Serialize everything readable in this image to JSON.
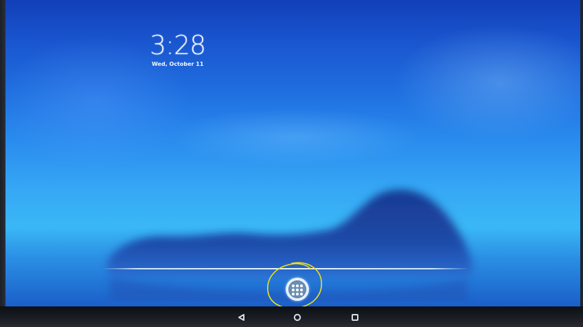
{
  "lockscreen": {
    "time": "3:28",
    "date": "Wed, October 11"
  },
  "launcher": {
    "all_apps_icon": "all-apps-grid-icon"
  },
  "navigation_bar": {
    "buttons": [
      {
        "name": "back",
        "icon": "back-triangle-icon"
      },
      {
        "name": "home",
        "icon": "home-circle-icon"
      },
      {
        "name": "recents",
        "icon": "recents-square-icon"
      }
    ]
  },
  "annotation": {
    "shape": "hand-drawn-circle",
    "color": "#f2e01a"
  },
  "colors": {
    "wallpaper_top": "#123fb8",
    "wallpaper_mid": "#36a8f5",
    "island": "#1a3f9a",
    "navbar": "#101317",
    "nav_icon": "#d8dde6"
  }
}
